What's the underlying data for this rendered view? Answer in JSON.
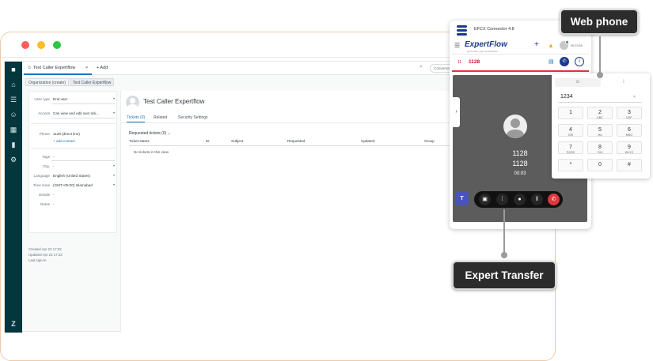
{
  "callouts": {
    "web_phone": "Web phone",
    "expert_transfer": "Expert Transfer"
  },
  "zendesk": {
    "tab": {
      "title": "Test Caller Expertflow",
      "close": "×",
      "add": "+ Add"
    },
    "breadcrumbs": [
      "Organization (create)",
      "Test Caller Expertflow"
    ],
    "search_tail": "Conversati",
    "fields": {
      "user_type": {
        "label": "User type",
        "value": "End user"
      },
      "access": {
        "label": "Access",
        "value": "Can view and edit own tick..."
      },
      "phone": {
        "label": "Phone",
        "value": "1128 (direct line)",
        "add": "+ add contact"
      },
      "tags": {
        "label": "Tags",
        "value": "-"
      },
      "org": {
        "label": "Org.",
        "value": "-"
      },
      "language": {
        "label": "Language",
        "value": "English (United States)"
      },
      "time_zone": {
        "label": "Time zone",
        "value": "(GMT+05:00) Islamabad"
      },
      "details": {
        "label": "Details",
        "value": "-"
      },
      "notes": {
        "label": "Notes",
        "value": "-"
      }
    },
    "meta": {
      "created": "Created  Apr 23 17:02",
      "updated": "Updated  Apr 23 17:23",
      "last_sign_in": "Last sign-in"
    },
    "user": {
      "name": "Test Caller Expertflow"
    },
    "user_tabs": [
      "Tickets (0)",
      "Related",
      "Security Settings"
    ],
    "requested": "Requested tickets (0) ⌄",
    "table": {
      "headers": [
        "Ticket status",
        "ID",
        "Subject",
        "Requested",
        "Updated",
        "Group"
      ],
      "empty": "No tickets in this view"
    }
  },
  "connector": {
    "title": "EFCX Connector 4.8",
    "brand": "ExpertFlow",
    "tagline": "your voice, your convenience",
    "timer_top": "00:23:59",
    "line_index": "11",
    "line_number": "1128",
    "caller_name": "1128",
    "caller_number": "1128",
    "call_timer": "00:03"
  },
  "dialpad": {
    "input": "1234",
    "keys": [
      {
        "d": "1",
        "s": ""
      },
      {
        "d": "2",
        "s": "ABC"
      },
      {
        "d": "3",
        "s": "DEF"
      },
      {
        "d": "4",
        "s": "GHI"
      },
      {
        "d": "5",
        "s": "JKL"
      },
      {
        "d": "6",
        "s": "MNO"
      },
      {
        "d": "7",
        "s": "PQRS"
      },
      {
        "d": "8",
        "s": "TUV"
      },
      {
        "d": "9",
        "s": "WXYZ"
      },
      {
        "d": "*",
        "s": ""
      },
      {
        "d": "0",
        "s": ""
      },
      {
        "d": "#",
        "s": ""
      }
    ]
  },
  "colors": {
    "rail": "#03363d",
    "accent": "#1f73b7",
    "hangup": "#e0363d",
    "danger_text": "#c8102e",
    "callout_bg": "#2c2c2c"
  }
}
